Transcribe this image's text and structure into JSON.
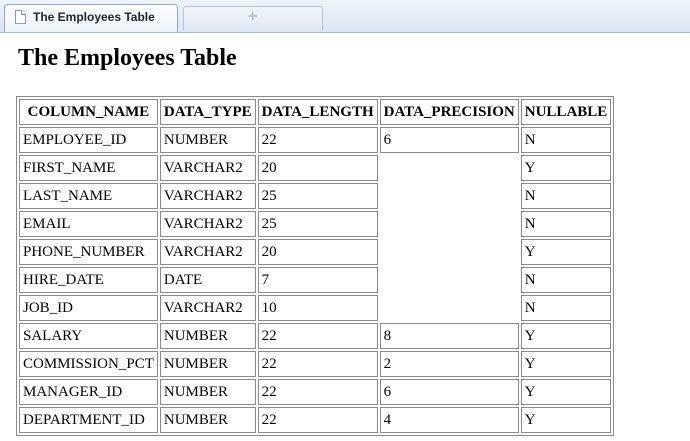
{
  "browser": {
    "tab_title": "The Employees Table",
    "new_tab_icon": "plus-icon"
  },
  "page": {
    "heading": "The Employees Table"
  },
  "table": {
    "columns": [
      "COLUMN_NAME",
      "DATA_TYPE",
      "DATA_LENGTH",
      "DATA_PRECISION",
      "NULLABLE"
    ],
    "rows": [
      [
        "EMPLOYEE_ID",
        "NUMBER",
        "22",
        "6",
        "N"
      ],
      [
        "FIRST_NAME",
        "VARCHAR2",
        "20",
        "",
        "Y"
      ],
      [
        "LAST_NAME",
        "VARCHAR2",
        "25",
        "",
        "N"
      ],
      [
        "EMAIL",
        "VARCHAR2",
        "25",
        "",
        "N"
      ],
      [
        "PHONE_NUMBER",
        "VARCHAR2",
        "20",
        "",
        "Y"
      ],
      [
        "HIRE_DATE",
        "DATE",
        "7",
        "",
        "N"
      ],
      [
        "JOB_ID",
        "VARCHAR2",
        "10",
        "",
        "N"
      ],
      [
        "SALARY",
        "NUMBER",
        "22",
        "8",
        "Y"
      ],
      [
        "COMMISSION_PCT",
        "NUMBER",
        "22",
        "2",
        "Y"
      ],
      [
        "MANAGER_ID",
        "NUMBER",
        "22",
        "6",
        "Y"
      ],
      [
        "DEPARTMENT_ID",
        "NUMBER",
        "22",
        "4",
        "Y"
      ]
    ]
  }
}
